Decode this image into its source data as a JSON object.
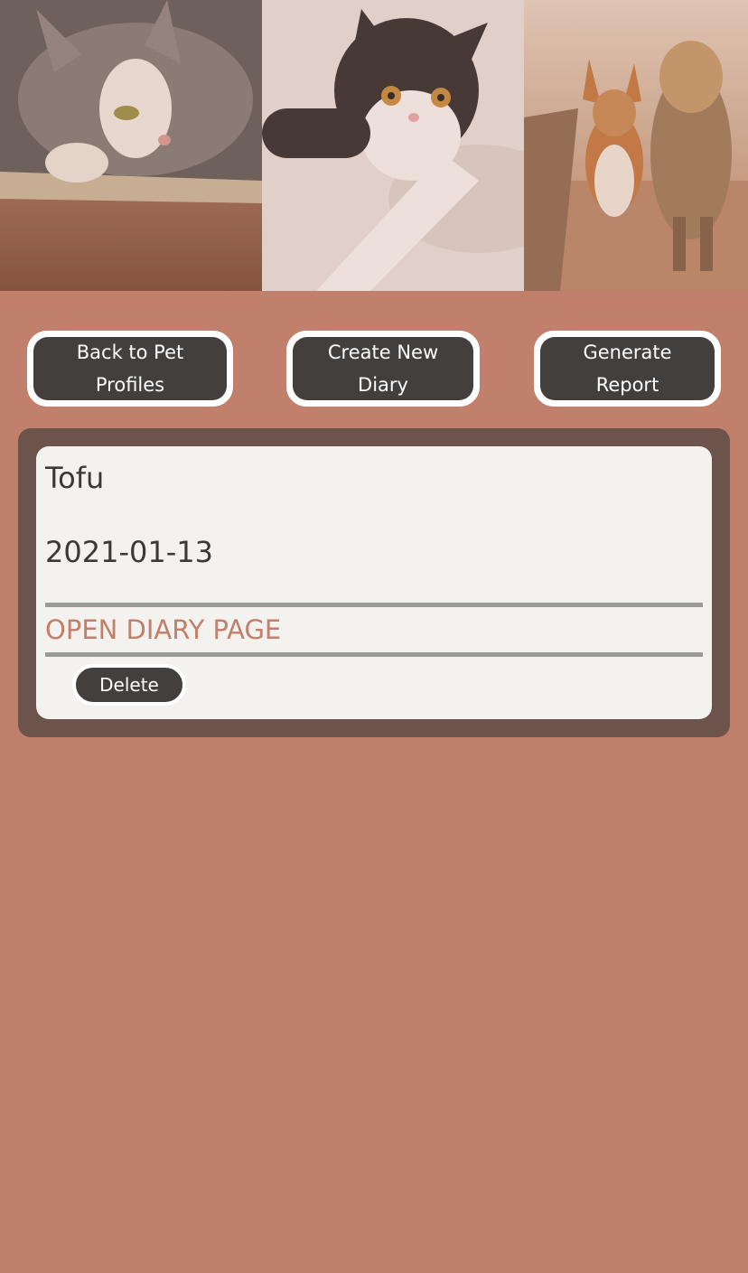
{
  "banner": {
    "photos": [
      {
        "subject": "grey-and-white-cat-lying-on-rug"
      },
      {
        "subject": "black-and-white-cat-on-bed"
      },
      {
        "subject": "two-dogs-running-on-path"
      }
    ]
  },
  "actions": {
    "back_label": "Back to Pet Profiles",
    "create_label": "Create New Diary",
    "report_label": "Generate Report"
  },
  "diary": {
    "entries": [
      {
        "pet_name": "Tofu",
        "date": "2021-01-13",
        "open_label": "OPEN DIARY PAGE",
        "delete_label": "Delete"
      }
    ]
  },
  "colors": {
    "background": "#c1806b",
    "button": "#433f3c",
    "panel": "#6c534b",
    "card": "#f3f2ef",
    "link": "#c1806b"
  }
}
